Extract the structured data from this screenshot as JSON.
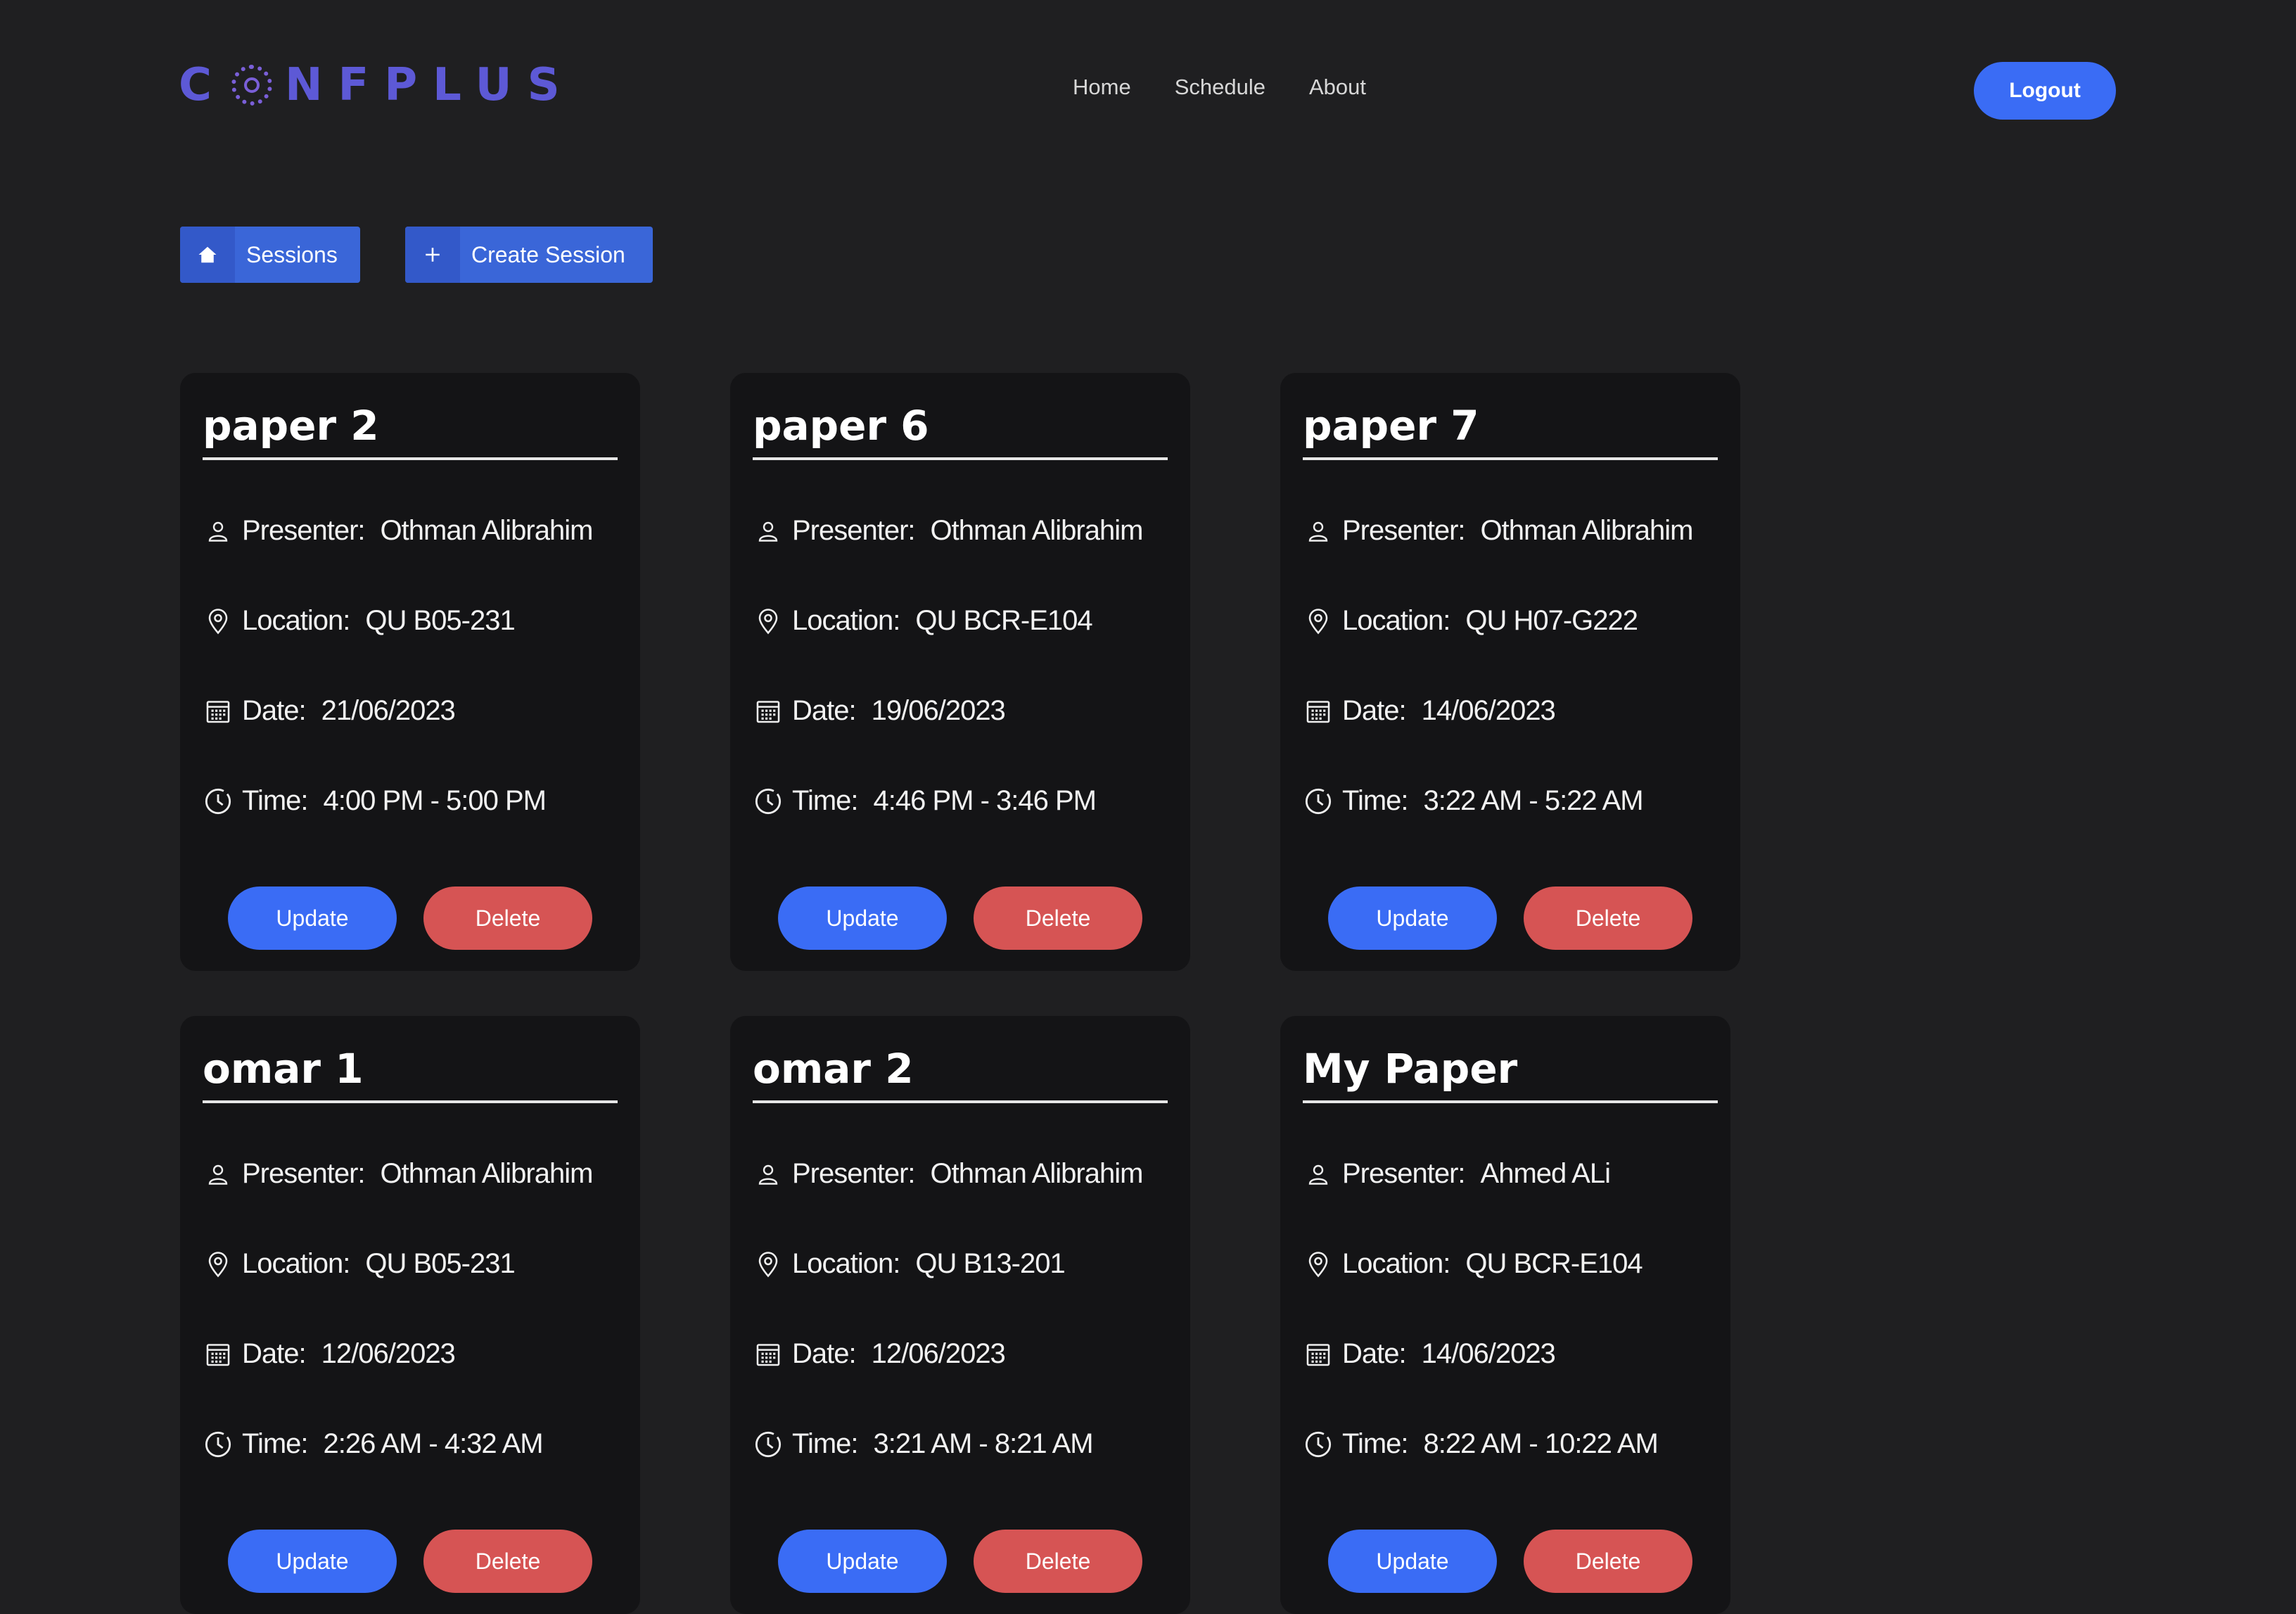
{
  "header": {
    "logo_text": "CONFPLUS",
    "nav": [
      "Home",
      "Schedule",
      "About"
    ],
    "logout_label": "Logout"
  },
  "toolbar": {
    "sessions_label": "Sessions",
    "create_label": "Create Session"
  },
  "labels": {
    "presenter": "Presenter:",
    "location": "Location:",
    "date": "Date:",
    "time": "Time:",
    "update": "Update",
    "delete": "Delete"
  },
  "sessions": [
    {
      "title": "paper 2",
      "presenter": "Othman Alibrahim",
      "location": "QU B05-231",
      "date": "21/06/2023",
      "time": "4:00 PM - 5:00 PM"
    },
    {
      "title": "paper 6",
      "presenter": "Othman Alibrahim",
      "location": "QU BCR-E104",
      "date": "19/06/2023",
      "time": "4:46 PM - 3:46 PM"
    },
    {
      "title": "paper 7",
      "presenter": "Othman Alibrahim",
      "location": "QU H07-G222",
      "date": "14/06/2023",
      "time": "3:22 AM - 5:22 AM"
    },
    {
      "title": "omar 1",
      "presenter": "Othman Alibrahim",
      "location": "QU B05-231",
      "date": "12/06/2023",
      "time": "2:26 AM - 4:32 AM"
    },
    {
      "title": "omar 2",
      "presenter": "Othman Alibrahim",
      "location": "QU B13-201",
      "date": "12/06/2023",
      "time": "3:21 AM - 8:21 AM"
    },
    {
      "title": "My Paper",
      "presenter": "Ahmed ALi",
      "location": "QU BCR-E104",
      "date": "14/06/2023",
      "time": "8:22 AM - 10:22 AM"
    }
  ]
}
